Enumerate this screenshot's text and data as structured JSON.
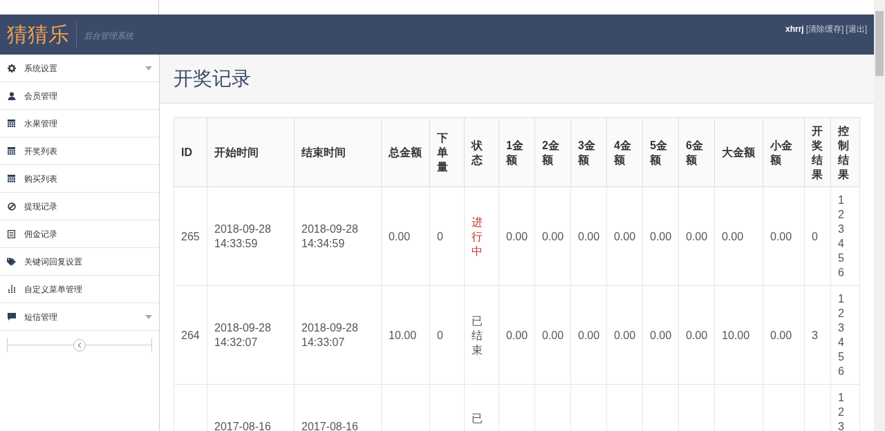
{
  "header": {
    "logo": "猜猜乐",
    "subtitle": "后台管理系统",
    "user": "xhrrj",
    "links": [
      "[清除缓存]",
      "[退出]"
    ]
  },
  "sidebar": {
    "items": [
      {
        "label": "系统设置",
        "expandable": true
      },
      {
        "label": "会员管理",
        "expandable": false
      },
      {
        "label": "水果管理",
        "expandable": false
      },
      {
        "label": "开奖列表",
        "expandable": false
      },
      {
        "label": "购买列表",
        "expandable": false
      },
      {
        "label": "提现记录",
        "expandable": false
      },
      {
        "label": "佣金记录",
        "expandable": false
      },
      {
        "label": "关键词回复设置",
        "expandable": false
      },
      {
        "label": "自定义菜单管理",
        "expandable": false
      },
      {
        "label": "短信管理",
        "expandable": true
      }
    ]
  },
  "page_title": "开奖记录",
  "table": {
    "columns": [
      "ID",
      "开始时间",
      "结束时间",
      "总金额",
      "下单量",
      "状态",
      "1金额",
      "2金额",
      "3金额",
      "4金额",
      "5金额",
      "6金额",
      "大金额",
      "小金额",
      "开奖结果",
      "控制结果"
    ],
    "rows": [
      {
        "cells": [
          "265",
          "2018-09-28 14:33:59",
          "2018-09-28 14:34:59",
          "0.00",
          "0",
          "进行中",
          "0.00",
          "0.00",
          "0.00",
          "0.00",
          "0.00",
          "0.00",
          "0.00",
          "0.00",
          "0",
          "1 2 3 4 5 6"
        ],
        "active": true
      },
      {
        "cells": [
          "264",
          "2018-09-28 14:32:07",
          "2018-09-28 14:33:07",
          "10.00",
          "0",
          "已结束",
          "0.00",
          "0.00",
          "0.00",
          "0.00",
          "0.00",
          "0.00",
          "10.00",
          "0.00",
          "3",
          "1 2 3 4 5 6"
        ],
        "active": false
      },
      {
        "cells": [
          "",
          "2017-08-16",
          "2017-08-16",
          "",
          "",
          "已",
          "",
          "",
          "",
          "",
          "",
          "",
          "",
          "",
          "",
          "1 2 3"
        ],
        "active": false
      }
    ]
  }
}
